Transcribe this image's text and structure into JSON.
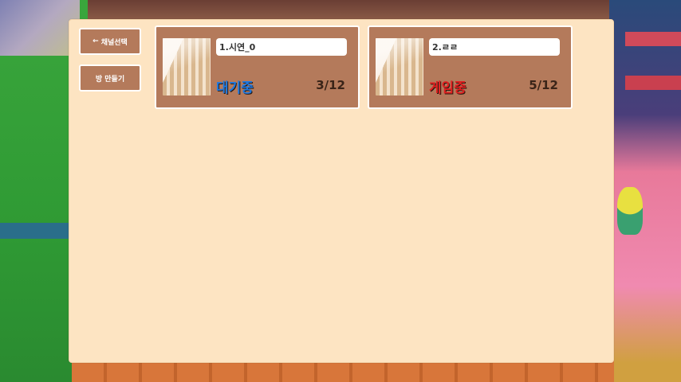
{
  "sidebar": {
    "back_icon": "left-arrow-icon",
    "back_label": "채널선택",
    "create_label": "방 만들기"
  },
  "rooms": [
    {
      "name": "1.시연_0",
      "status": "대기중",
      "status_color": "#1e78e0",
      "players": "3/12"
    },
    {
      "name": "2.ㄹㄹ",
      "status": "게임중",
      "status_color": "#e02020",
      "players": "5/12"
    }
  ],
  "colors": {
    "panel": "#fde4c2",
    "button": "#b47a5b",
    "room_card": "#b47a5b"
  }
}
